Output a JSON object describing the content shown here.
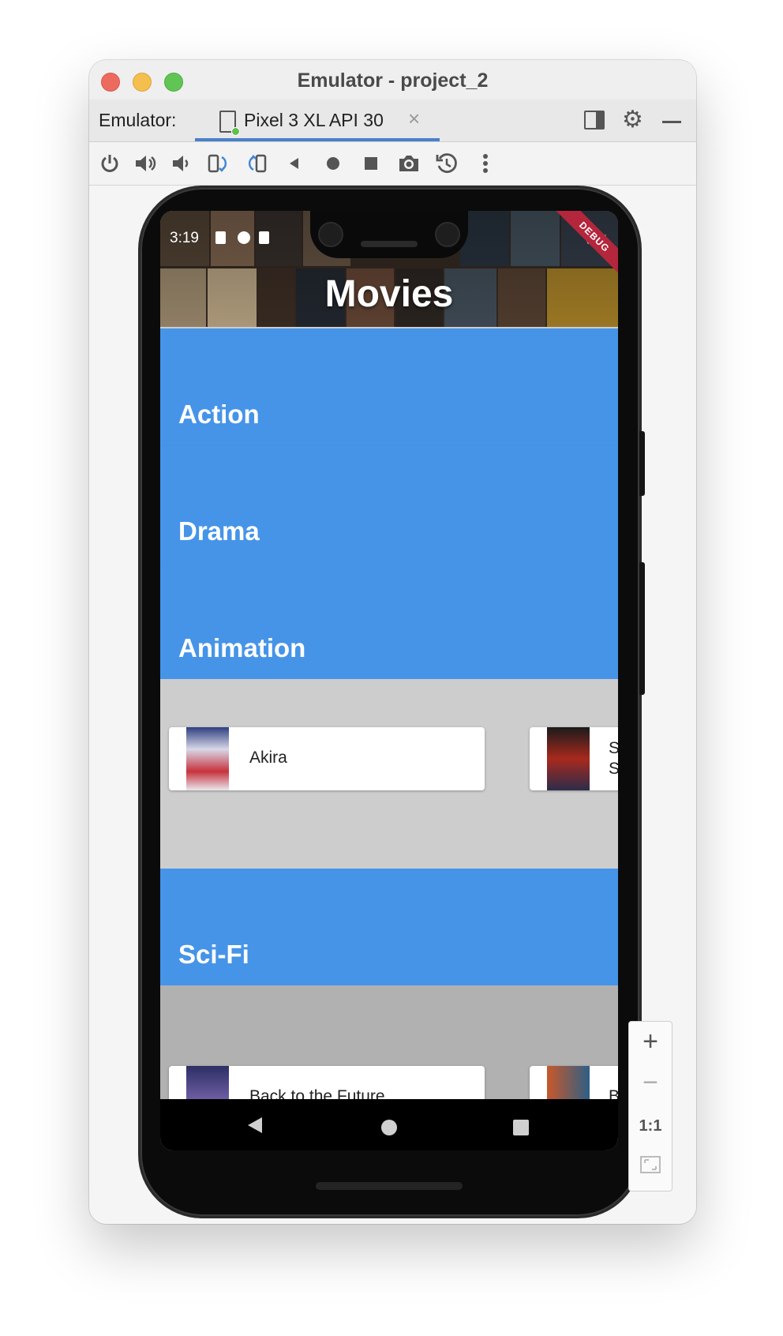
{
  "window": {
    "title": "Emulator - project_2"
  },
  "tabbar": {
    "label": "Emulator:",
    "active_tab": "Pixel 3 XL API 30",
    "close_glyph": "×"
  },
  "toolbar": {
    "icons": [
      "power-icon",
      "volume-up-icon",
      "volume-down-icon",
      "rotate-left-icon",
      "rotate-right-icon",
      "back-icon",
      "home-icon",
      "overview-icon",
      "camera-icon",
      "snapshot-icon",
      "more-icon"
    ]
  },
  "phone": {
    "status": {
      "time": "3:19",
      "debug_banner": "DEBUG"
    },
    "app_title": "Movies",
    "categories": [
      {
        "label": "Action"
      },
      {
        "label": "Drama"
      },
      {
        "label": "Animation"
      },
      {
        "label": "Sci-Fi"
      }
    ],
    "animation_movies": [
      {
        "title": "Akira"
      },
      {
        "title": "S S"
      }
    ],
    "scifi_movies": [
      {
        "title": "Back to the Future"
      },
      {
        "title": "B"
      }
    ]
  },
  "zoom": {
    "plus": "+",
    "minus": "−",
    "actual": "1:1"
  },
  "colors": {
    "category_blue": "#4694e8",
    "row_bg_light": "#cdcdcd",
    "row_bg_dark": "#b1b1b1",
    "tab_accent": "#4a7fcb"
  }
}
